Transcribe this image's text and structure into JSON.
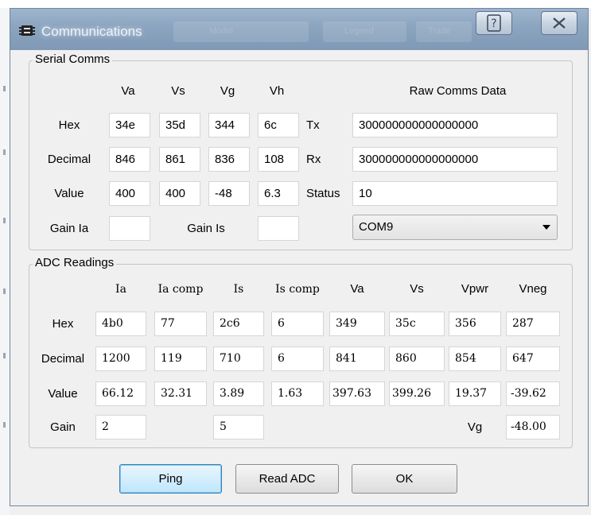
{
  "window": {
    "title": "Communications",
    "help_glyph": "?",
    "close_glyph": "✕",
    "background_ghost": [
      "Model",
      "Legend",
      "Trade"
    ]
  },
  "serial": {
    "legend": "Serial Comms",
    "columns": [
      "Va",
      "Vs",
      "Vg",
      "Vh"
    ],
    "raw_header": "Raw Comms Data",
    "rows": [
      {
        "label": "Hex",
        "values": [
          "34e",
          "35d",
          "344",
          "6c"
        ],
        "raw_label": "Tx",
        "raw_value": "300000000000000000"
      },
      {
        "label": "Decimal",
        "values": [
          "846",
          "861",
          "836",
          "108"
        ],
        "raw_label": "Rx",
        "raw_value": "300000000000000000"
      },
      {
        "label": "Value",
        "values": [
          "400",
          "400",
          "-48",
          "6.3"
        ],
        "raw_label": "Status",
        "raw_value": "10"
      }
    ],
    "gain_ia_label": "Gain Ia",
    "gain_ia_value": "",
    "gain_is_label": "Gain Is",
    "gain_is_value": "",
    "port": "COM9"
  },
  "adc": {
    "legend": "ADC Readings",
    "columns": [
      "Ia",
      "Ia comp",
      "Is",
      "Is comp",
      "Va",
      "Vs",
      "Vpwr",
      "Vneg"
    ],
    "rows": [
      {
        "label": "Hex",
        "values": [
          "4b0",
          "77",
          "2c6",
          "6",
          "349",
          "35c",
          "356",
          "287"
        ]
      },
      {
        "label": "Decimal",
        "values": [
          "1200",
          "119",
          "710",
          "6",
          "841",
          "860",
          "854",
          "647"
        ]
      },
      {
        "label": "Value",
        "values": [
          "66.12",
          "32.31",
          "3.89",
          "1.63",
          "397.63",
          "399.26",
          "19.37",
          "-39.62"
        ]
      }
    ],
    "gain_label": "Gain",
    "gain_ia": "2",
    "gain_is": "5",
    "vg_label": "Vg",
    "vg_value": "-48.00"
  },
  "buttons": {
    "ping": "Ping",
    "read_adc": "Read ADC",
    "ok": "OK"
  },
  "colors": {
    "titlebar": "#8ba4bf",
    "focus_button": "#bee6fd"
  }
}
